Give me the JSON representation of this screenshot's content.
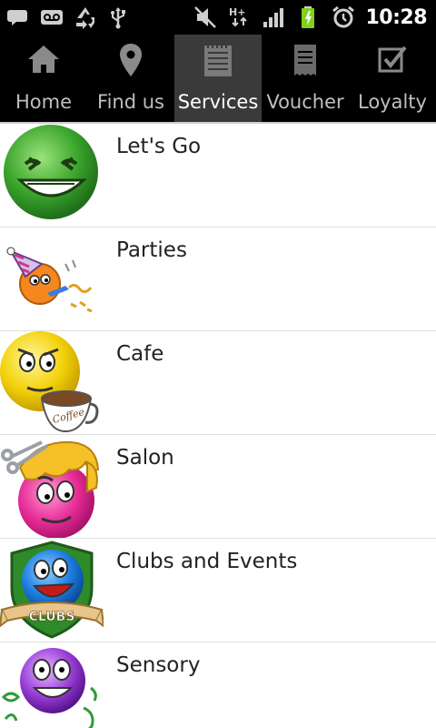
{
  "status_bar": {
    "time": "10:28",
    "left_icons": [
      "chat-icon",
      "voicemail-icon",
      "recycle-icon",
      "usb-icon"
    ],
    "right_icons": [
      "mute-icon",
      "hplus-data-icon",
      "signal-icon",
      "battery-charging-icon",
      "alarm-icon"
    ],
    "network_label": "H+"
  },
  "tabs": [
    {
      "label": "Home",
      "icon": "home-icon",
      "selected": false
    },
    {
      "label": "Find us",
      "icon": "map-pin-icon",
      "selected": false
    },
    {
      "label": "Services",
      "icon": "notepad-icon",
      "selected": true
    },
    {
      "label": "Voucher",
      "icon": "receipt-icon",
      "selected": false
    },
    {
      "label": "Loyalty",
      "icon": "checkbox-icon",
      "selected": false
    }
  ],
  "services": [
    {
      "label": "Let's Go",
      "icon": "green-smiley-icon"
    },
    {
      "label": "Parties",
      "icon": "party-smiley-icon"
    },
    {
      "label": "Cafe",
      "icon": "coffee-smiley-icon",
      "cup_text": "Coffee"
    },
    {
      "label": "Salon",
      "icon": "salon-smiley-icon"
    },
    {
      "label": "Clubs and Events",
      "icon": "clubs-smiley-icon",
      "badge_text": "CLUBS"
    },
    {
      "label": "Sensory",
      "icon": "sensory-smiley-icon"
    }
  ],
  "colors": {
    "status_bar_bg": "#000000",
    "tab_bar_bg": "#000000",
    "tab_selected_bg": "#3a3a3a",
    "list_bg": "#ffffff",
    "divider": "#dedede"
  }
}
